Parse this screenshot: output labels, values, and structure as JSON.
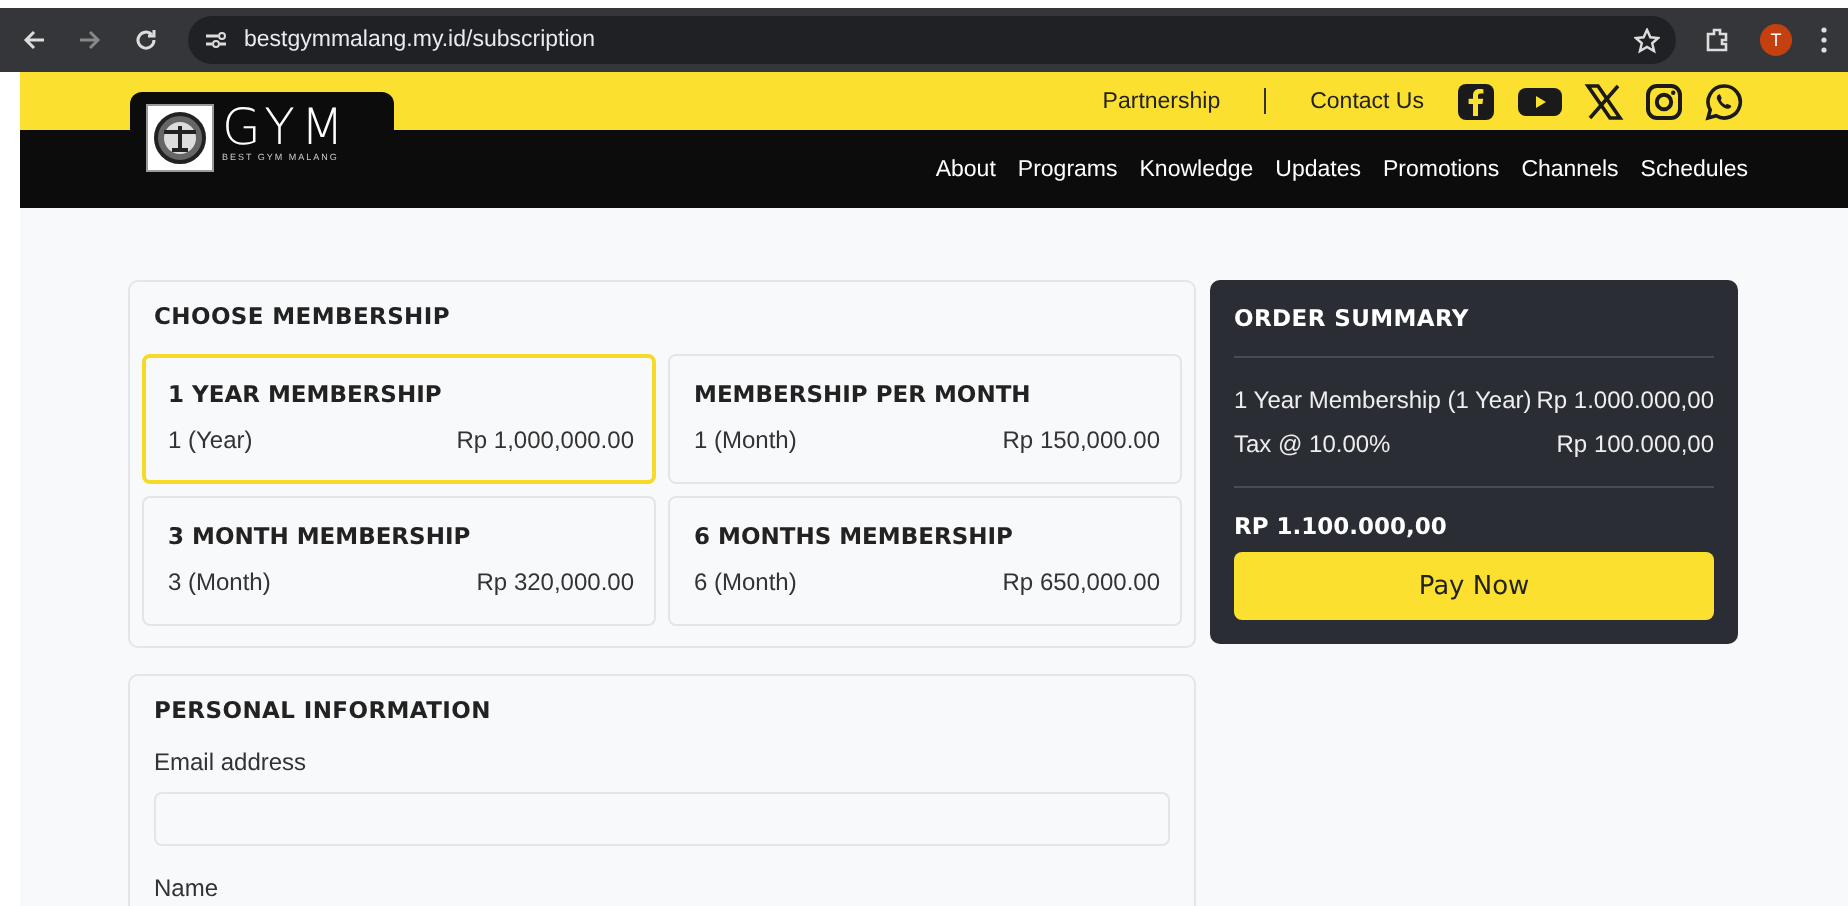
{
  "browser": {
    "url": "bestgymmalang.my.id/subscription",
    "avatar": "T"
  },
  "topbar": {
    "links": [
      "Partnership",
      "Contact Us"
    ],
    "social": [
      {
        "kind": "facebook"
      },
      {
        "kind": "youtube"
      },
      {
        "kind": "x"
      },
      {
        "kind": "instagram"
      },
      {
        "kind": "whatsapp"
      }
    ]
  },
  "logo": {
    "title": "GYM",
    "tagline": "BEST GYM MALANG"
  },
  "nav": [
    "About",
    "Programs",
    "Knowledge",
    "Updates",
    "Promotions",
    "Channels",
    "Schedules"
  ],
  "membership": {
    "title": "CHOOSE MEMBERSHIP",
    "plans": [
      {
        "name": "1 YEAR MEMBERSHIP",
        "duration": "1 (Year)",
        "price": "Rp 1,000,000.00",
        "selected": true
      },
      {
        "name": "MEMBERSHIP PER MONTH",
        "duration": "1 (Month)",
        "price": "Rp 150,000.00",
        "selected": false
      },
      {
        "name": "3 MONTH MEMBERSHIP",
        "duration": "3 (Month)",
        "price": "Rp 320,000.00",
        "selected": false
      },
      {
        "name": "6 MONTHS MEMBERSHIP",
        "duration": "6 (Month)",
        "price": "Rp 650,000.00",
        "selected": false
      }
    ]
  },
  "summary": {
    "title": "ORDER SUMMARY",
    "lines": [
      {
        "label": "1 Year Membership (1 Year)",
        "amount": "Rp 1.000.000,00"
      },
      {
        "label": "Tax @ 10.00%",
        "amount": "Rp 100.000,00"
      }
    ],
    "total": "RP 1.100.000,00",
    "button": "Pay Now"
  },
  "personal": {
    "title": "PERSONAL INFORMATION",
    "fields": [
      {
        "label": "Email address",
        "kind": "input"
      },
      {
        "label": "Name",
        "kind": "label"
      }
    ]
  }
}
